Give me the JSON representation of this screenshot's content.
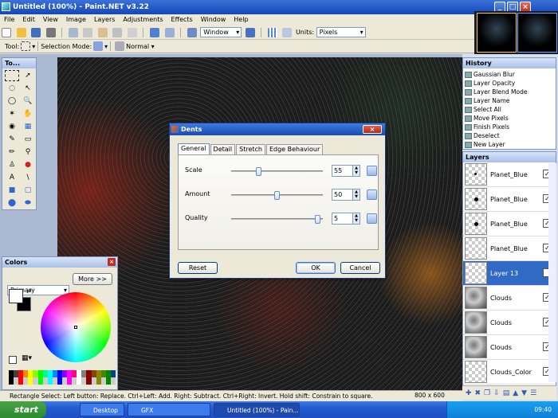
{
  "window": {
    "title": "Untitled (100%) - Paint.NET v3.22",
    "min": "_",
    "max": "□",
    "close": "×"
  },
  "menu": [
    "File",
    "Edit",
    "View",
    "Image",
    "Layers",
    "Adjustments",
    "Effects",
    "Window",
    "Help"
  ],
  "toolbar": {
    "zoom_value": "Window",
    "units_label": "Units:",
    "units_value": "Pixels"
  },
  "toolbar2": {
    "tool_label": "Tool:",
    "selection_mode_label": "Selection Mode:",
    "blend_value": "Normal"
  },
  "tools_panel": {
    "title": "To..."
  },
  "colors_panel": {
    "title": "Colors",
    "primary": "Primary",
    "more": "More >>",
    "close": "×"
  },
  "history": {
    "title": "History",
    "items": [
      "Gaussian Blur",
      "Layer Opacity",
      "Layer Blend Mode",
      "Layer Name",
      "Select All",
      "Move Pixels",
      "Finish Pixels",
      "Deselect",
      "New Layer"
    ]
  },
  "layers": {
    "title": "Layers",
    "items": [
      {
        "name": "Planet_Blue",
        "checked": "✓"
      },
      {
        "name": "Planet_Blue",
        "checked": "✓"
      },
      {
        "name": "Planet_Blue",
        "checked": "✓"
      },
      {
        "name": "Planet_Blue",
        "checked": "✓"
      },
      {
        "name": "Layer 13",
        "checked": "✓"
      },
      {
        "name": "Clouds",
        "checked": "✓"
      },
      {
        "name": "Clouds",
        "checked": "✓"
      },
      {
        "name": "Clouds",
        "checked": "✓"
      },
      {
        "name": "Clouds_Color",
        "checked": "✓"
      }
    ]
  },
  "dialog": {
    "title": "Dents",
    "close": "×",
    "tabs": [
      "General",
      "Detail",
      "Stretch",
      "Edge Behaviour"
    ],
    "params": [
      {
        "label": "Scale",
        "value": "55",
        "level": 0.29
      },
      {
        "label": "Amount",
        "value": "50",
        "level": 0.5
      },
      {
        "label": "Quality",
        "value": "5",
        "level": 0.97
      }
    ],
    "reset": "Reset",
    "ok": "OK",
    "cancel": "Cancel"
  },
  "status": {
    "hint": "Rectangle Select: Left button: Replace. Ctrl+Left: Add. Right: Subtract. Ctrl+Right: Invert. Hold shift: Constrain to square.",
    "size": "800 x 600"
  },
  "taskbar": {
    "start": "start",
    "tasks": [
      "Desktop",
      "GFX",
      "Untitled (100%) - Pain..."
    ],
    "clock": "09:40"
  },
  "colors": {
    "accent": "#316ac5",
    "titlebar": "#1546b8"
  }
}
